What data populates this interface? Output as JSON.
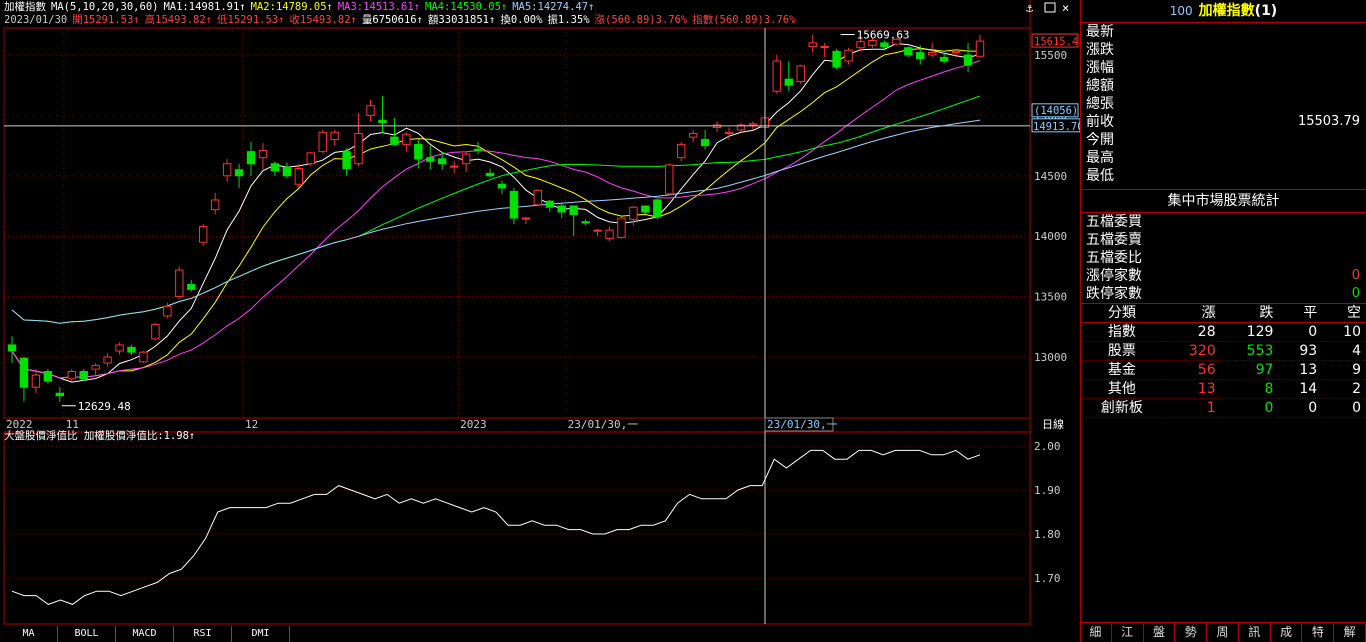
{
  "header": {
    "name": "加權指數",
    "ma_title": "MA(5,10,20,30,60)",
    "mas": [
      {
        "label": "MA1:14981.91↑",
        "color": "#ffffff"
      },
      {
        "label": "MA2:14789.05↑",
        "color": "#ffff00"
      },
      {
        "label": "MA3:14513.61↑",
        "color": "#ff40ff"
      },
      {
        "label": "MA4:14530.05↑",
        "color": "#00ff00"
      },
      {
        "label": "MA5:14274.47↑",
        "color": "#9fd0ff"
      }
    ],
    "line2": [
      {
        "label": "2023/01/30",
        "color": "#cccccc"
      },
      {
        "label": "開15291.53↑",
        "color": "#ff4040"
      },
      {
        "label": "高15493.82↑",
        "color": "#ff4040"
      },
      {
        "label": "低15291.53↑",
        "color": "#ff4040"
      },
      {
        "label": "收15493.82↑",
        "color": "#ff4040"
      },
      {
        "label": "量6750616↑",
        "color": "#ffffff"
      },
      {
        "label": "額33031851↑",
        "color": "#ffffff"
      },
      {
        "label": "換0.00%",
        "color": "#ffffff"
      },
      {
        "label": "振1.35%",
        "color": "#ffffff"
      },
      {
        "label": "漲(560.89)3.76%",
        "color": "#ff4040"
      },
      {
        "label": "指數(560.89)3.76%",
        "color": "#ff4040"
      }
    ]
  },
  "sub_header": "大盤股價淨值比 加權股價淨值比:1.98↑",
  "chart_data": {
    "type": "candlestick",
    "y_ticks": [
      "15500",
      "15000",
      "14500",
      "14000",
      "13500",
      "13000"
    ],
    "sub_y_ticks": [
      "2.00",
      "1.90",
      "1.80",
      "1.70"
    ],
    "x_labels": [
      {
        "label": "2022",
        "idx": 0
      },
      {
        "label": "11",
        "idx": 5
      },
      {
        "label": "12",
        "idx": 20
      },
      {
        "label": "2023",
        "idx": 38
      },
      {
        "label": "23/01/30,一",
        "idx": 47
      }
    ],
    "axis_label": "日線",
    "cursor_price": "14913.70",
    "cursor_paren": "(14056)",
    "last_price": "15615.4",
    "high_label": "15669.63",
    "low_label": "12629.48",
    "candles": [
      [
        13100,
        13170,
        12950,
        13050
      ],
      [
        12990,
        13000,
        12630,
        12750
      ],
      [
        12750,
        12900,
        12700,
        12850
      ],
      [
        12880,
        12900,
        12780,
        12800
      ],
      [
        12700,
        12750,
        12630,
        12680
      ],
      [
        12820,
        12900,
        12800,
        12880
      ],
      [
        12880,
        12900,
        12800,
        12820
      ],
      [
        12900,
        12950,
        12850,
        12930
      ],
      [
        12950,
        13030,
        12920,
        13000
      ],
      [
        13050,
        13120,
        13020,
        13100
      ],
      [
        13080,
        13100,
        13020,
        13040
      ],
      [
        12960,
        13050,
        12950,
        13040
      ],
      [
        13150,
        13280,
        13140,
        13270
      ],
      [
        13340,
        13450,
        13320,
        13420
      ],
      [
        13500,
        13750,
        13480,
        13720
      ],
      [
        13600,
        13640,
        13540,
        13560
      ],
      [
        13950,
        14100,
        13920,
        14080
      ],
      [
        14220,
        14360,
        14180,
        14300
      ],
      [
        14500,
        14640,
        14450,
        14600
      ],
      [
        14550,
        14600,
        14400,
        14500
      ],
      [
        14700,
        14780,
        14500,
        14600
      ],
      [
        14650,
        14770,
        14550,
        14710
      ],
      [
        14600,
        14620,
        14500,
        14540
      ],
      [
        14570,
        14610,
        14480,
        14500
      ],
      [
        14430,
        14600,
        14400,
        14560
      ],
      [
        14600,
        14700,
        14580,
        14690
      ],
      [
        14700,
        14880,
        14690,
        14860
      ],
      [
        14800,
        14880,
        14750,
        14860
      ],
      [
        14700,
        14730,
        14500,
        14560
      ],
      [
        14600,
        15020,
        14580,
        14850
      ],
      [
        15000,
        15130,
        14950,
        15080
      ],
      [
        14960,
        15160,
        14850,
        14940
      ],
      [
        14820,
        14980,
        14750,
        14760
      ],
      [
        14760,
        14860,
        14700,
        14840
      ],
      [
        14760,
        14800,
        14560,
        14640
      ],
      [
        14650,
        14750,
        14550,
        14620
      ],
      [
        14640,
        14700,
        14550,
        14600
      ],
      [
        14580,
        14620,
        14520,
        14580
      ],
      [
        14600,
        14700,
        14530,
        14680
      ],
      [
        14720,
        14780,
        14680,
        14710
      ],
      [
        14520,
        14560,
        14480,
        14500
      ],
      [
        14430,
        14460,
        14350,
        14400
      ],
      [
        14370,
        14400,
        14100,
        14150
      ],
      [
        14150,
        14160,
        14100,
        14150
      ],
      [
        14260,
        14390,
        14250,
        14380
      ],
      [
        14290,
        14300,
        14200,
        14240
      ],
      [
        14250,
        14280,
        14150,
        14200
      ],
      [
        14250,
        14250,
        14000,
        14180
      ],
      [
        14120,
        14140,
        14090,
        14110
      ],
      [
        14050,
        14060,
        14000,
        14050
      ],
      [
        13980,
        14080,
        13960,
        14050
      ],
      [
        13990,
        14160,
        13980,
        14150
      ],
      [
        14140,
        14250,
        14090,
        14240
      ],
      [
        14250,
        14250,
        14180,
        14200
      ],
      [
        14300,
        14310,
        14140,
        14160
      ],
      [
        14350,
        14600,
        14340,
        14590
      ],
      [
        14650,
        14780,
        14620,
        14760
      ],
      [
        14820,
        14880,
        14780,
        14850
      ],
      [
        14800,
        14880,
        14720,
        14750
      ],
      [
        14900,
        14950,
        14860,
        14920
      ],
      [
        14850,
        14900,
        14800,
        14860
      ],
      [
        14880,
        14940,
        14870,
        14920
      ],
      [
        14920,
        14950,
        14880,
        14930
      ],
      [
        14900,
        15040,
        14880,
        14980
      ],
      [
        15200,
        15500,
        15180,
        15450
      ],
      [
        15300,
        15450,
        15200,
        15250
      ],
      [
        15280,
        15420,
        15260,
        15410
      ],
      [
        15570,
        15670,
        15520,
        15600
      ],
      [
        15570,
        15600,
        15480,
        15570
      ],
      [
        15530,
        15550,
        15380,
        15400
      ],
      [
        15450,
        15560,
        15420,
        15540
      ],
      [
        15560,
        15640,
        15530,
        15610
      ],
      [
        15580,
        15640,
        15560,
        15620
      ],
      [
        15600,
        15620,
        15550,
        15570
      ],
      [
        15590,
        15640,
        15580,
        15630
      ],
      [
        15560,
        15570,
        15480,
        15500
      ],
      [
        15520,
        15580,
        15420,
        15470
      ],
      [
        15500,
        15600,
        15480,
        15520
      ],
      [
        15480,
        15520,
        15430,
        15450
      ],
      [
        15520,
        15550,
        15480,
        15530
      ],
      [
        15500,
        15600,
        15360,
        15420
      ],
      [
        15490,
        15669,
        15480,
        15615
      ]
    ],
    "sub_values": [
      1.67,
      1.66,
      1.66,
      1.64,
      1.65,
      1.64,
      1.66,
      1.67,
      1.67,
      1.66,
      1.67,
      1.68,
      1.69,
      1.71,
      1.72,
      1.75,
      1.79,
      1.85,
      1.86,
      1.86,
      1.86,
      1.86,
      1.87,
      1.87,
      1.88,
      1.89,
      1.89,
      1.91,
      1.9,
      1.89,
      1.88,
      1.89,
      1.87,
      1.88,
      1.87,
      1.88,
      1.87,
      1.86,
      1.85,
      1.86,
      1.85,
      1.82,
      1.82,
      1.83,
      1.82,
      1.82,
      1.81,
      1.81,
      1.8,
      1.8,
      1.81,
      1.81,
      1.82,
      1.82,
      1.83,
      1.87,
      1.89,
      1.88,
      1.88,
      1.88,
      1.9,
      1.91,
      1.91,
      1.97,
      1.95,
      1.97,
      1.99,
      1.99,
      1.97,
      1.97,
      1.99,
      1.99,
      1.98,
      1.99,
      1.99,
      1.99,
      1.98,
      1.98,
      1.99,
      1.97,
      1.98
    ]
  },
  "right_panel": {
    "code": "100",
    "title": "加權指數",
    "title_suffix": "(1)",
    "quote_rows": [
      {
        "label": "最新",
        "value": ""
      },
      {
        "label": "漲跌",
        "value": ""
      },
      {
        "label": "漲幅",
        "value": ""
      },
      {
        "label": "總額",
        "value": ""
      },
      {
        "label": "總張",
        "value": ""
      },
      {
        "label": "前收",
        "value": "15503.79"
      },
      {
        "label": "今開",
        "value": ""
      },
      {
        "label": "最高",
        "value": ""
      },
      {
        "label": "最低",
        "value": ""
      }
    ],
    "stats_title": "集中市場股票統計",
    "stat_rows": [
      {
        "label": "五檔委買",
        "value": "",
        "cls": ""
      },
      {
        "label": "五檔委賣",
        "value": "",
        "cls": ""
      },
      {
        "label": "五檔委比",
        "value": "",
        "cls": ""
      },
      {
        "label": "漲停家數",
        "value": "0",
        "cls": "red"
      },
      {
        "label": "跌停家數",
        "value": "0",
        "cls": "green"
      }
    ],
    "table_head": [
      "分類",
      "漲",
      "跌",
      "平",
      "空"
    ],
    "table_rows": [
      {
        "name": "指數",
        "up": "28",
        "down": "129",
        "flat": "0",
        "empty": "10",
        "upcls": "",
        "downcls": ""
      },
      {
        "name": "股票",
        "up": "320",
        "down": "553",
        "flat": "93",
        "empty": "4",
        "upcls": "red",
        "downcls": "green"
      },
      {
        "name": "基金",
        "up": "56",
        "down": "97",
        "flat": "13",
        "empty": "9",
        "upcls": "red",
        "downcls": "green"
      },
      {
        "name": "其他",
        "up": "13",
        "down": "8",
        "flat": "14",
        "empty": "2",
        "upcls": "red",
        "downcls": "green"
      },
      {
        "name": "創新板",
        "up": "1",
        "down": "0",
        "flat": "0",
        "empty": "0",
        "upcls": "red",
        "downcls": "green"
      }
    ],
    "tabs": [
      "細",
      "江",
      "盤",
      "勢",
      "周",
      "訊",
      "成",
      "特",
      "解"
    ]
  },
  "bottom_tabs": [
    "MA",
    "BOLL",
    "MACD",
    "RSI",
    "DMI"
  ]
}
